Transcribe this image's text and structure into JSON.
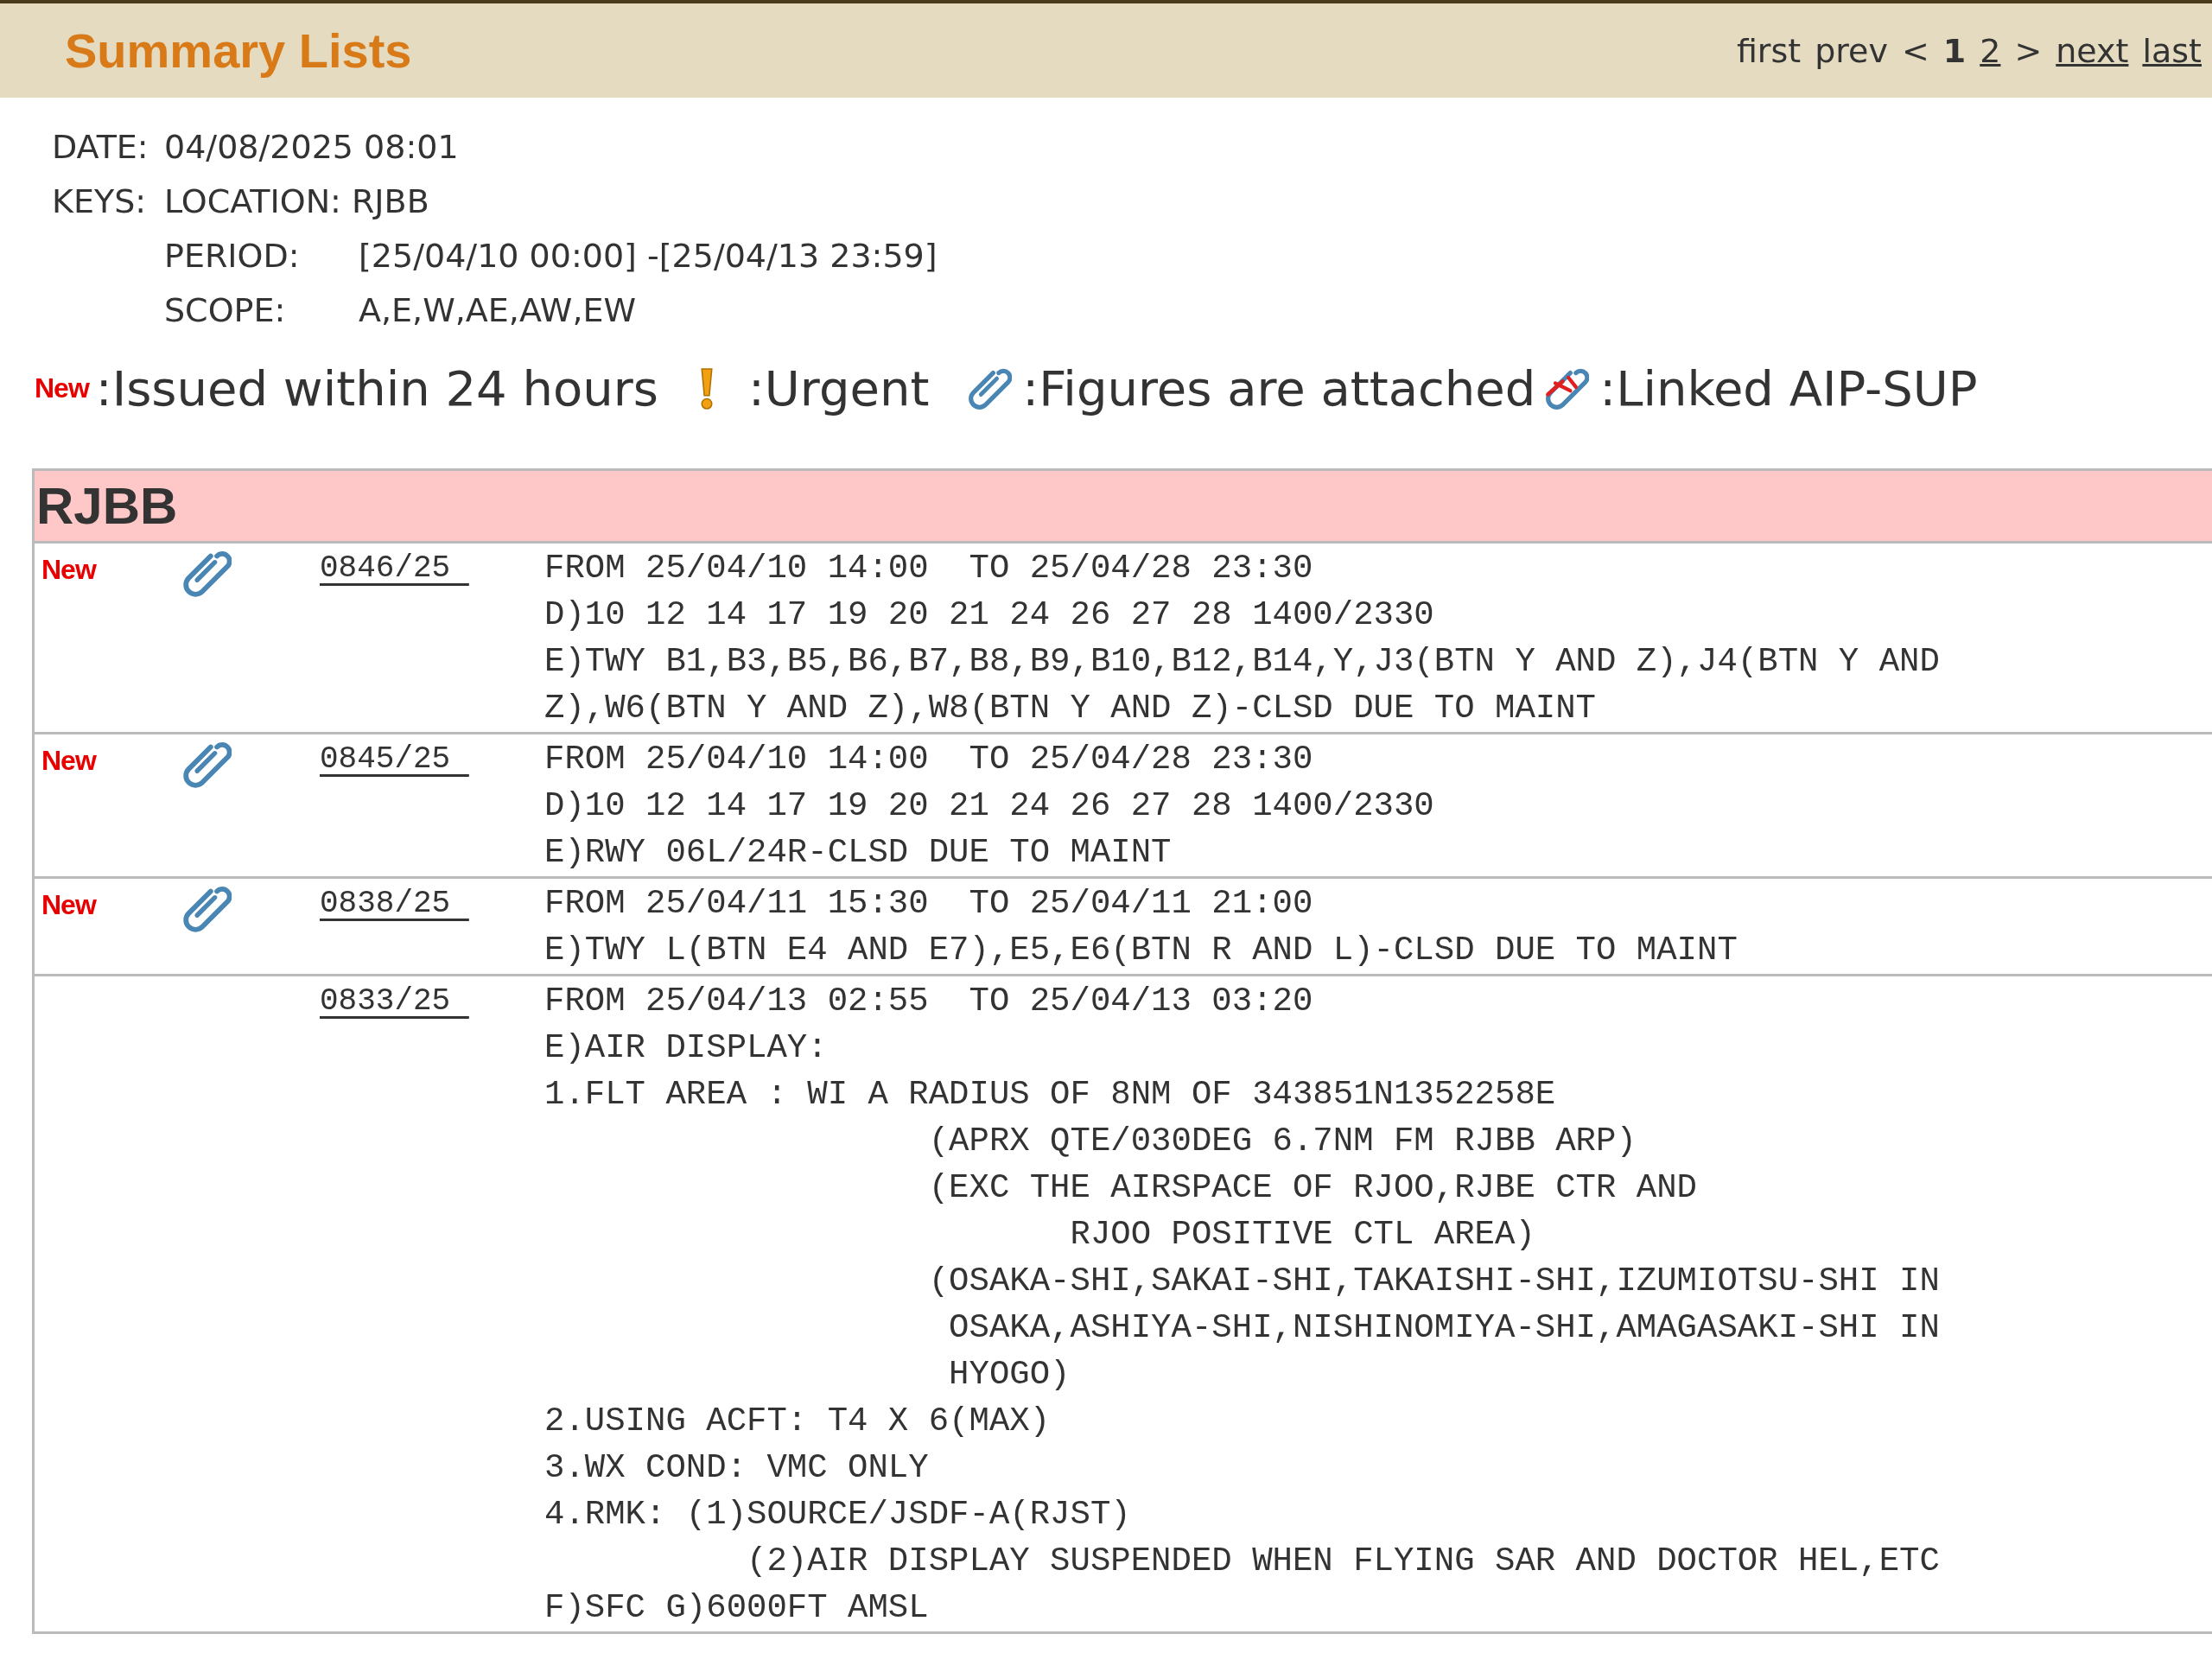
{
  "header": {
    "title": "Summary Lists",
    "pager": [
      {
        "label": "first",
        "kind": "text"
      },
      {
        "label": "prev",
        "kind": "text"
      },
      {
        "label": "<",
        "kind": "text"
      },
      {
        "label": "1",
        "kind": "current"
      },
      {
        "label": "2",
        "kind": "link"
      },
      {
        "label": ">",
        "kind": "text"
      },
      {
        "label": "next",
        "kind": "link"
      },
      {
        "label": "last",
        "kind": "link"
      }
    ]
  },
  "info": {
    "date_label": "DATE:",
    "date": "04/08/2025 08:01",
    "keys_label": "KEYS:",
    "location_label": "LOCATION:",
    "location": "RJBB",
    "fields": [
      {
        "label": "PERIOD:",
        "value": "[25/04/10 00:00] -[25/04/13 23:59]"
      },
      {
        "label": "SCOPE:",
        "value": "A,E,W,AE,AW,EW"
      }
    ]
  },
  "legend": [
    {
      "kind": "new",
      "badge": "New",
      "text": ":Issued within 24 hours"
    },
    {
      "kind": "urgent",
      "text": ":Urgent"
    },
    {
      "kind": "figures",
      "text": ":Figures are attached"
    },
    {
      "kind": "aip",
      "text": ":Linked AIP-SUP"
    }
  ],
  "group": {
    "title": "RJBB",
    "rows": [
      {
        "new": true,
        "badge": "New",
        "attachment": true,
        "number": "0846/25",
        "lines": [
          "FROM 25/04/10 14:00  TO 25/04/28 23:30",
          "D)10 12 14 17 19 20 21 24 26 27 28 1400/2330",
          "E)TWY B1,B3,B5,B6,B7,B8,B9,B10,B12,B14,Y,J3(BTN Y AND Z),J4(BTN Y AND",
          "Z),W6(BTN Y AND Z),W8(BTN Y AND Z)-CLSD DUE TO MAINT"
        ]
      },
      {
        "new": true,
        "badge": "New",
        "attachment": true,
        "number": "0845/25",
        "lines": [
          "FROM 25/04/10 14:00  TO 25/04/28 23:30",
          "D)10 12 14 17 19 20 21 24 26 27 28 1400/2330",
          "E)RWY 06L/24R-CLSD DUE TO MAINT"
        ]
      },
      {
        "new": true,
        "badge": "New",
        "attachment": true,
        "number": "0838/25",
        "lines": [
          "FROM 25/04/11 15:30  TO 25/04/11 21:00",
          "E)TWY L(BTN E4 AND E7),E5,E6(BTN R AND L)-CLSD DUE TO MAINT"
        ]
      },
      {
        "new": false,
        "attachment": false,
        "number": "0833/25",
        "lines": [
          "FROM 25/04/13 02:55  TO 25/04/13 03:20",
          "E)AIR DISPLAY:",
          "1.FLT AREA : WI A RADIUS OF 8NM OF 343851N1352258E",
          "                   (APRX QTE/030DEG 6.7NM FM RJBB ARP)",
          "                   (EXC THE AIRSPACE OF RJOO,RJBE CTR AND",
          "                          RJOO POSITIVE CTL AREA)",
          "                   (OSAKA-SHI,SAKAI-SHI,TAKAISHI-SHI,IZUMIOTSU-SHI IN",
          "                    OSAKA,ASHIYA-SHI,NISHINOMIYA-SHI,AMAGASAKI-SHI IN",
          "                    HYOGO)",
          "2.USING ACFT: T4 X 6(MAX)",
          "3.WX COND: VMC ONLY",
          "4.RMK: (1)SOURCE/JSDF-A(RJST)",
          "          (2)AIR DISPLAY SUSPENDED WHEN FLYING SAR AND DOCTOR HEL,ETC",
          "F)SFC G)6000FT AMSL"
        ]
      }
    ]
  }
}
